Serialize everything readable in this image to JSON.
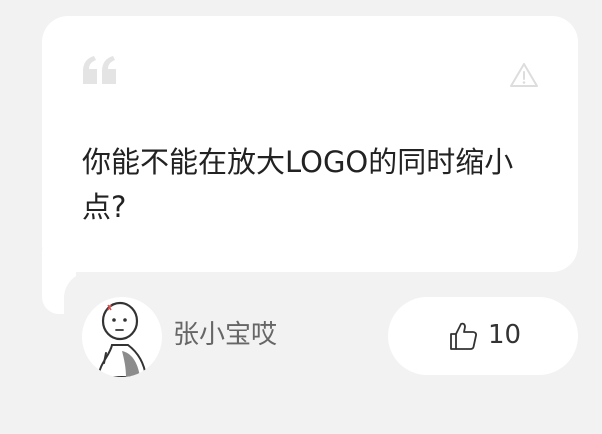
{
  "question": {
    "text": "你能不能在放大LOGO的同时缩小点?"
  },
  "icons": {
    "quote": "quote-icon",
    "report": "warning-triangle-icon",
    "like": "thumbs-up-icon"
  },
  "author": {
    "name": "张小宝哎",
    "avatar": "cartoon-person-avatar"
  },
  "likes": {
    "count": "10"
  },
  "colors": {
    "page_background": "#f2f2f2",
    "card_background": "#ffffff",
    "question_text": "#222222",
    "author_text": "#666666",
    "icon_muted": "#e0e0e0"
  }
}
